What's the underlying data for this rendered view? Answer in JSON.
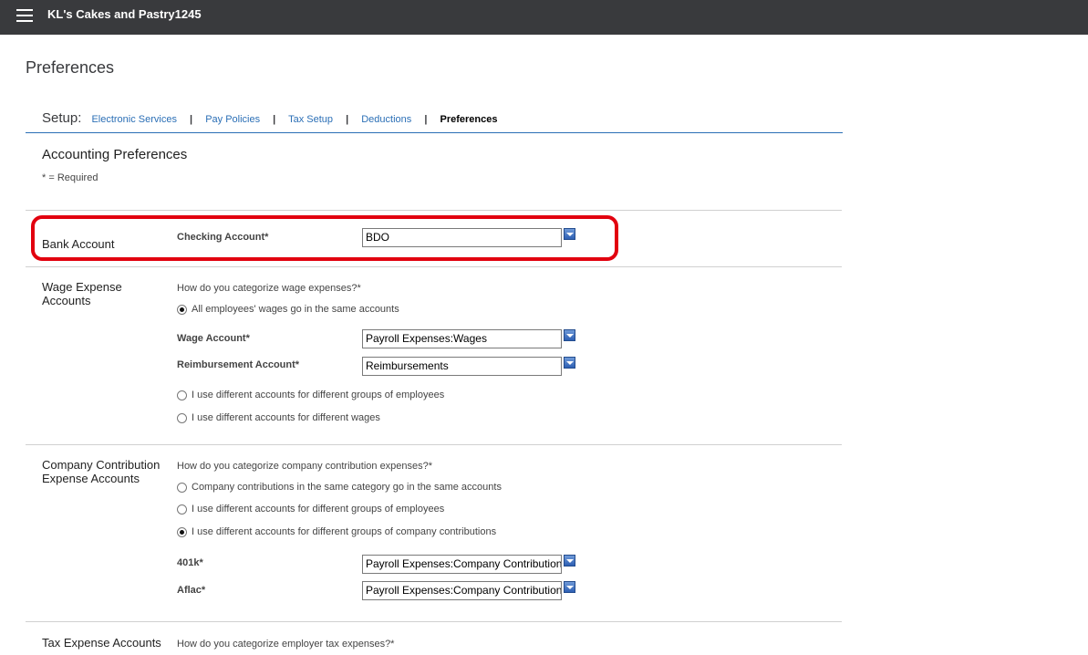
{
  "header": {
    "company_name": "KL's Cakes and Pastry1245"
  },
  "page_title": "Preferences",
  "setup_nav": {
    "label": "Setup:",
    "links": [
      "Electronic Services",
      "Pay Policies",
      "Tax Setup",
      "Deductions"
    ],
    "separator": "|",
    "current": "Preferences"
  },
  "section_title": "Accounting Preferences",
  "required_note": "* = Required",
  "bank": {
    "heading": "Bank Account",
    "checking_label": "Checking Account*",
    "checking_value": "BDO"
  },
  "wage": {
    "heading": "Wage Expense Accounts",
    "question": "How do you categorize wage expenses?*",
    "options": [
      "All employees' wages go in the same accounts",
      "I use different accounts for different groups of employees",
      "I use different accounts for different wages"
    ],
    "selected_option_index": 0,
    "wage_account_label": "Wage Account*",
    "wage_account_value": "Payroll Expenses:Wages",
    "reimb_label": "Reimbursement Account*",
    "reimb_value": "Reimbursements"
  },
  "company": {
    "heading": "Company Contribution Expense Accounts",
    "question": "How do you categorize company contribution expenses?*",
    "options": [
      "Company contributions in the same category go in the same accounts",
      "I use different accounts for different groups of employees",
      "I use different accounts for different groups of company contributions"
    ],
    "selected_option_index": 2,
    "k401_label": "401k*",
    "k401_value": "Payroll Expenses:Company Contributions",
    "aflac_label": "Aflac*",
    "aflac_value": "Payroll Expenses:Company Contributions"
  },
  "tax": {
    "heading": "Tax Expense Accounts",
    "question": "How do you categorize employer tax expenses?*"
  },
  "colors": {
    "topbar": "#393a3d",
    "link": "#2b6fb6",
    "highlight": "#e2000f"
  }
}
